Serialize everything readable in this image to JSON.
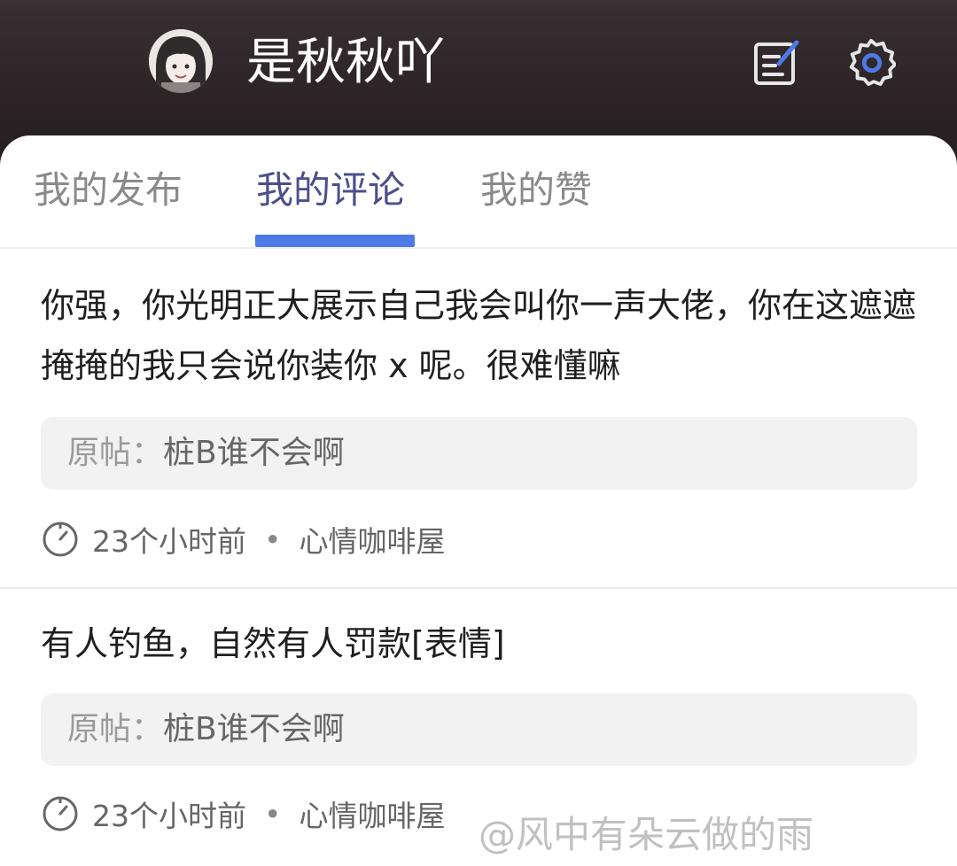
{
  "header": {
    "username": "是秋秋吖",
    "icons": {
      "avatar": "avatar-image",
      "edit": "edit-icon",
      "settings": "gear-icon"
    },
    "accent": "#4e7ae5"
  },
  "tabs": [
    {
      "label": "我的发布",
      "active": false
    },
    {
      "label": "我的评论",
      "active": true
    },
    {
      "label": "我的赞",
      "active": false
    }
  ],
  "comments": [
    {
      "text": "你强，你光明正大展示自己我会叫你一声大佬，你在这遮遮掩掩的我只会说你装你 x 呢。很难懂嘛",
      "origin_label": "原帖：",
      "origin_title": "桩B谁不会啊",
      "time": "23个小时前",
      "separator": "•",
      "community": "心情咖啡屋"
    },
    {
      "text": "有人钓鱼，自然有人罚款[表情]",
      "origin_label": "原帖：",
      "origin_title": "桩B谁不会啊",
      "time": "23个小时前",
      "separator": "•",
      "community": "心情咖啡屋"
    }
  ],
  "watermark": "@风中有朵云做的雨"
}
